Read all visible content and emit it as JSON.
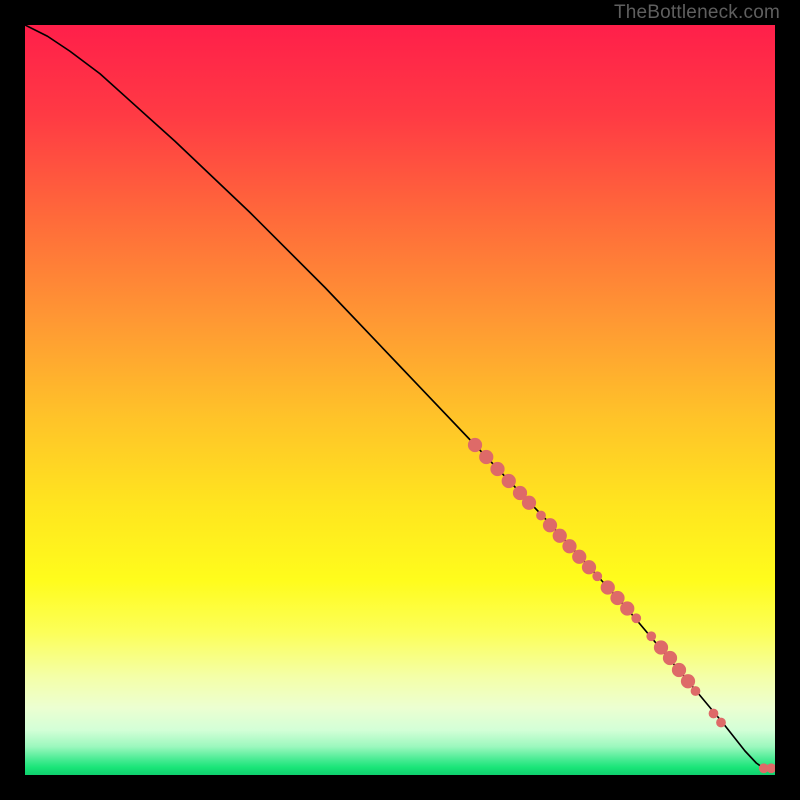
{
  "attribution": "TheBottleneck.com",
  "colors": {
    "dot": "#de6a68",
    "curve": "#000000",
    "accent_green": "#19e578"
  },
  "chart_data": {
    "type": "line",
    "title": "",
    "xlabel": "",
    "ylabel": "",
    "xlim": [
      0,
      100
    ],
    "ylim": [
      0,
      100
    ],
    "grid": false,
    "series": [
      {
        "name": "curve",
        "kind": "line",
        "x": [
          0,
          3,
          6,
          10,
          20,
          30,
          40,
          50,
          60,
          70,
          80,
          88,
          93,
          96,
          97.5,
          98.5,
          100
        ],
        "y": [
          100,
          98.5,
          96.5,
          93.5,
          84.5,
          75,
          65,
          54.5,
          44,
          33.5,
          22.5,
          13,
          7,
          3.2,
          1.6,
          0.9,
          0.9
        ]
      },
      {
        "name": "highlight-dots",
        "kind": "scatter",
        "r_small": 0.65,
        "r_large": 0.95,
        "points": [
          {
            "x": 60.0,
            "y": 44.0,
            "r": 0.95
          },
          {
            "x": 61.5,
            "y": 42.4,
            "r": 0.95
          },
          {
            "x": 63.0,
            "y": 40.8,
            "r": 0.95
          },
          {
            "x": 64.5,
            "y": 39.2,
            "r": 0.95
          },
          {
            "x": 66.0,
            "y": 37.6,
            "r": 0.95
          },
          {
            "x": 67.2,
            "y": 36.3,
            "r": 0.95
          },
          {
            "x": 68.8,
            "y": 34.6,
            "r": 0.65
          },
          {
            "x": 70.0,
            "y": 33.3,
            "r": 0.95
          },
          {
            "x": 71.3,
            "y": 31.9,
            "r": 0.95
          },
          {
            "x": 72.6,
            "y": 30.5,
            "r": 0.95
          },
          {
            "x": 73.9,
            "y": 29.1,
            "r": 0.95
          },
          {
            "x": 75.2,
            "y": 27.7,
            "r": 0.95
          },
          {
            "x": 76.3,
            "y": 26.5,
            "r": 0.65
          },
          {
            "x": 77.7,
            "y": 25.0,
            "r": 0.95
          },
          {
            "x": 79.0,
            "y": 23.6,
            "r": 0.95
          },
          {
            "x": 80.3,
            "y": 22.2,
            "r": 0.95
          },
          {
            "x": 81.5,
            "y": 20.9,
            "r": 0.65
          },
          {
            "x": 83.5,
            "y": 18.5,
            "r": 0.65
          },
          {
            "x": 84.8,
            "y": 17.0,
            "r": 0.95
          },
          {
            "x": 86.0,
            "y": 15.6,
            "r": 0.95
          },
          {
            "x": 87.2,
            "y": 14.0,
            "r": 0.95
          },
          {
            "x": 88.4,
            "y": 12.5,
            "r": 0.95
          },
          {
            "x": 89.4,
            "y": 11.2,
            "r": 0.65
          },
          {
            "x": 91.8,
            "y": 8.2,
            "r": 0.65
          },
          {
            "x": 92.8,
            "y": 7.0,
            "r": 0.65
          },
          {
            "x": 98.5,
            "y": 0.9,
            "r": 0.65
          },
          {
            "x": 99.5,
            "y": 0.9,
            "r": 0.65
          }
        ]
      }
    ],
    "background_gradient": {
      "stops": [
        {
          "t": 0.0,
          "color": "#ff1f4a"
        },
        {
          "t": 0.12,
          "color": "#ff3a44"
        },
        {
          "t": 0.26,
          "color": "#ff6b3a"
        },
        {
          "t": 0.4,
          "color": "#ff9a33"
        },
        {
          "t": 0.52,
          "color": "#ffc229"
        },
        {
          "t": 0.64,
          "color": "#ffe51f"
        },
        {
          "t": 0.74,
          "color": "#fffc1c"
        },
        {
          "t": 0.81,
          "color": "#fcff59"
        },
        {
          "t": 0.87,
          "color": "#f4ffa9"
        },
        {
          "t": 0.91,
          "color": "#ecffd1"
        },
        {
          "t": 0.94,
          "color": "#d3ffd7"
        },
        {
          "t": 0.962,
          "color": "#9cf8be"
        },
        {
          "t": 0.978,
          "color": "#4eec96"
        },
        {
          "t": 0.99,
          "color": "#19e578"
        },
        {
          "t": 1.0,
          "color": "#0fcf6e"
        }
      ]
    }
  }
}
